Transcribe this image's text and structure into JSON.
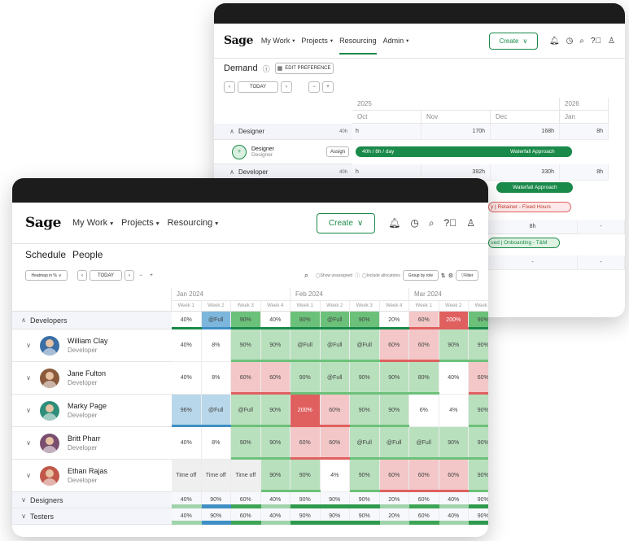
{
  "colors": {
    "accent": "#1a8a4a",
    "green_light": "#b8e0bd",
    "green_mid": "#6cc17a",
    "green_dark": "#3da555",
    "red_light": "#f3c7c7",
    "red_dark": "#e06060",
    "blue_light": "#b9d7ea",
    "blue_dark": "#3f8fc4",
    "gray_light": "#efefef"
  },
  "back_window": {
    "logo": "Sage",
    "nav": [
      {
        "label": "My Work",
        "caret": true
      },
      {
        "label": "Projects",
        "caret": true
      },
      {
        "label": "Resourcing",
        "caret": false,
        "active": true
      },
      {
        "label": "Admin",
        "caret": true
      }
    ],
    "create_label": "Create",
    "icons": [
      "bell-icon",
      "clock-icon",
      "search-icon",
      "help-icon",
      "user-icon"
    ],
    "page_title": "Demand",
    "toolbar_button": "EDIT PREFERENCE",
    "today_label": "TODAY",
    "years": [
      "2025",
      "2026"
    ],
    "months": [
      "Oct",
      "Nov",
      "Dec",
      "Jan"
    ],
    "groups": [
      {
        "label": "Designer",
        "badge": "40h",
        "values": [
          "h",
          "170h",
          "168h",
          "8h"
        ]
      },
      {
        "label": "Developer",
        "badge": "40h",
        "values": [
          "h",
          "392h",
          "330h",
          "8h"
        ]
      }
    ],
    "designer_row": {
      "name": "Designer",
      "role": "Designer",
      "assign": "Assign",
      "bar1": "40h / 8h / day",
      "bar2": "Waterfall Approach"
    },
    "right_items": [
      {
        "text": "Waterfall Approach"
      },
      {
        "text": "y | Retainer - Fixed Hours"
      },
      {
        "text": "8h"
      },
      {
        "text": "ued | Onboarding - T&M"
      }
    ]
  },
  "front_window": {
    "logo": "Sage",
    "nav": [
      {
        "label": "My Work"
      },
      {
        "label": "Projects"
      },
      {
        "label": "Resourcing"
      }
    ],
    "create_label": "Create",
    "icons": [
      "bell-icon",
      "clock-icon",
      "search-icon",
      "help-icon",
      "user-icon"
    ],
    "tabs": [
      "Schedule",
      "People"
    ],
    "controls": {
      "view_select": "Heatmap in %",
      "today": "TODAY",
      "unit_select": "Group by role",
      "filter": "Filter",
      "pills": [
        "Show unassigned",
        "Include allocations"
      ]
    },
    "months": [
      "Jan 2024",
      "Feb 2024",
      "Mar 2024"
    ],
    "weeks": [
      "Week 1",
      "Week 2",
      "Week 3",
      "Week 4",
      "Week 1",
      "Week 2",
      "Week 3",
      "Week 4",
      "Week 1",
      "Week 2",
      "Week 3"
    ],
    "developers_group": {
      "label": "Developers",
      "cells": [
        {
          "v": "40%",
          "c": "white"
        },
        {
          "v": "@Full",
          "c": "blue_mid"
        },
        {
          "v": "90%",
          "c": "green_mid"
        },
        {
          "v": "40%",
          "c": "white"
        },
        {
          "v": "90%",
          "c": "green_mid"
        },
        {
          "v": "@Full",
          "c": "green_mid"
        },
        {
          "v": "90%",
          "c": "green_mid"
        },
        {
          "v": "20%",
          "c": "white"
        },
        {
          "v": "60%",
          "c": "red_light"
        },
        {
          "v": "200%",
          "c": "red_dark"
        },
        {
          "v": "90%",
          "c": "green_mid"
        }
      ]
    },
    "people": [
      {
        "name": "William Clay",
        "role": "Developer",
        "avatar": "#3a6ea5",
        "cells": [
          {
            "v": "40%",
            "c": "white"
          },
          {
            "v": "8%",
            "c": "white"
          },
          {
            "v": "90%",
            "c": "green_light"
          },
          {
            "v": "90%",
            "c": "green_light"
          },
          {
            "v": "@Full",
            "c": "green_light"
          },
          {
            "v": "@Full",
            "c": "green_light"
          },
          {
            "v": "@Full",
            "c": "green_light"
          },
          {
            "v": "60%",
            "c": "red_light"
          },
          {
            "v": "60%",
            "c": "red_light"
          },
          {
            "v": "90%",
            "c": "green_light"
          },
          {
            "v": "90%",
            "c": "green_light"
          }
        ]
      },
      {
        "name": "Jane Fulton",
        "role": "Developer",
        "avatar": "#8a5a3c",
        "cells": [
          {
            "v": "40%",
            "c": "white"
          },
          {
            "v": "8%",
            "c": "white"
          },
          {
            "v": "60%",
            "c": "red_light"
          },
          {
            "v": "60%",
            "c": "red_light"
          },
          {
            "v": "90%",
            "c": "green_light"
          },
          {
            "v": "@Full",
            "c": "green_light"
          },
          {
            "v": "90%",
            "c": "green_light"
          },
          {
            "v": "90%",
            "c": "green_light"
          },
          {
            "v": "80%",
            "c": "green_light"
          },
          {
            "v": "40%",
            "c": "white"
          },
          {
            "v": "60%",
            "c": "red_light"
          }
        ]
      },
      {
        "name": "Marky Page",
        "role": "Developer",
        "avatar": "#2f8f7a",
        "cells": [
          {
            "v": "96%",
            "c": "blue_light"
          },
          {
            "v": "@Full",
            "c": "blue_light"
          },
          {
            "v": "@Full",
            "c": "green_light"
          },
          {
            "v": "90%",
            "c": "green_light"
          },
          {
            "v": "200%",
            "c": "red_dark"
          },
          {
            "v": "60%",
            "c": "red_light"
          },
          {
            "v": "90%",
            "c": "green_light"
          },
          {
            "v": "90%",
            "c": "green_light"
          },
          {
            "v": "6%",
            "c": "white"
          },
          {
            "v": "4%",
            "c": "white"
          },
          {
            "v": "90%",
            "c": "green_light"
          }
        ]
      },
      {
        "name": "Britt Pharr",
        "role": "Developer",
        "avatar": "#7a4e6e",
        "cells": [
          {
            "v": "40%",
            "c": "white"
          },
          {
            "v": "8%",
            "c": "white"
          },
          {
            "v": "90%",
            "c": "green_light"
          },
          {
            "v": "90%",
            "c": "green_light"
          },
          {
            "v": "60%",
            "c": "red_light"
          },
          {
            "v": "60%",
            "c": "red_light"
          },
          {
            "v": "@Full",
            "c": "green_light"
          },
          {
            "v": "@Full",
            "c": "green_light"
          },
          {
            "v": "@Full",
            "c": "green_light"
          },
          {
            "v": "90%",
            "c": "green_light"
          },
          {
            "v": "90%",
            "c": "green_light"
          }
        ]
      },
      {
        "name": "Ethan Rajas",
        "role": "Developer",
        "avatar": "#c0584a",
        "cells": [
          {
            "v": "Time off",
            "c": "gray"
          },
          {
            "v": "Time off",
            "c": "gray"
          },
          {
            "v": "Time off",
            "c": "gray"
          },
          {
            "v": "90%",
            "c": "green_light"
          },
          {
            "v": "90%",
            "c": "green_light"
          },
          {
            "v": "4%",
            "c": "white"
          },
          {
            "v": "90%",
            "c": "green_light"
          },
          {
            "v": "60%",
            "c": "red_light"
          },
          {
            "v": "60%",
            "c": "red_light"
          },
          {
            "v": "60%",
            "c": "red_light"
          },
          {
            "v": "90%",
            "c": "green_light"
          }
        ]
      }
    ],
    "collapsed_groups": [
      {
        "label": "Designers",
        "cells": [
          "40%",
          "90%",
          "60%",
          "40%",
          "90%",
          "90%",
          "90%",
          "20%",
          "60%",
          "40%",
          "90%"
        ]
      },
      {
        "label": "Testers",
        "cells": [
          "40%",
          "90%",
          "60%",
          "40%",
          "90%",
          "90%",
          "90%",
          "20%",
          "60%",
          "40%",
          "90%"
        ]
      }
    ]
  }
}
